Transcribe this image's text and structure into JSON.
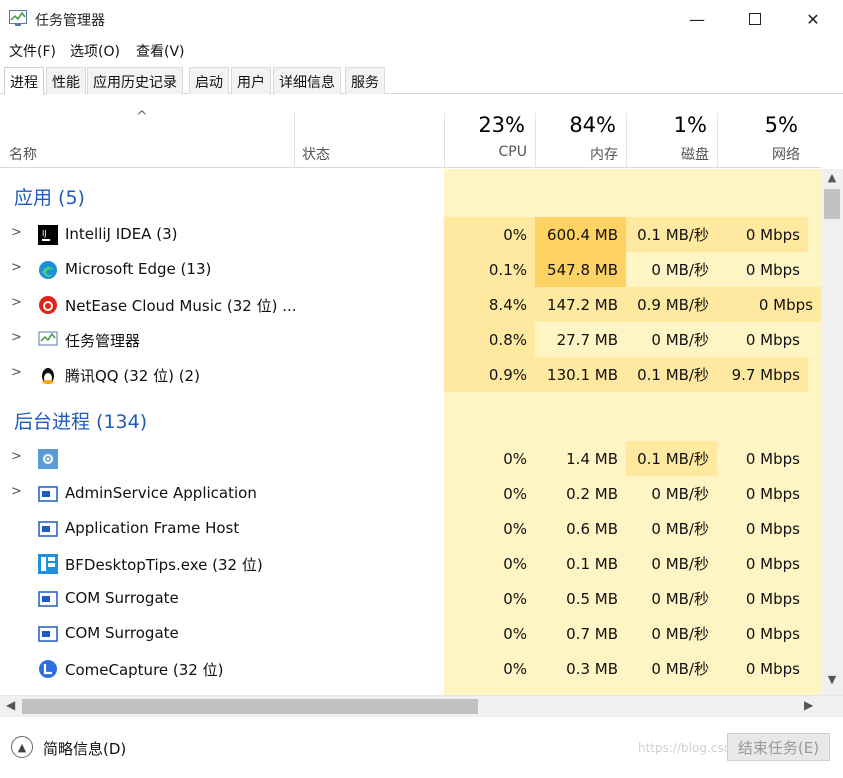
{
  "window": {
    "title": "任务管理器"
  },
  "menu": [
    "文件(F)",
    "选项(O)",
    "查看(V)"
  ],
  "tabs": [
    "进程",
    "性能",
    "应用历史记录",
    "启动",
    "用户",
    "详细信息",
    "服务"
  ],
  "header": {
    "name": "名称",
    "status": "状态",
    "cpu": {
      "pct": "23%",
      "label": "CPU"
    },
    "mem": {
      "pct": "84%",
      "label": "内存"
    },
    "disk": {
      "pct": "1%",
      "label": "磁盘"
    },
    "net": {
      "pct": "5%",
      "label": "网络"
    }
  },
  "groups": {
    "apps": "应用 (5)",
    "background": "后台进程 (134)"
  },
  "apps": [
    {
      "name": "IntelliJ IDEA (3)",
      "cpu": "0%",
      "mem": "600.4 MB",
      "disk": "0.1 MB/秒",
      "net": "0 Mbps"
    },
    {
      "name": "Microsoft Edge (13)",
      "cpu": "0.1%",
      "mem": "547.8 MB",
      "disk": "0 MB/秒",
      "net": "0 Mbps"
    },
    {
      "name": "NetEase Cloud Music (32 位) ...",
      "cpu": "8.4%",
      "mem": "147.2 MB",
      "disk": "0.9 MB/秒",
      "net": "0 Mbps"
    },
    {
      "name": "任务管理器",
      "cpu": "0.8%",
      "mem": "27.7 MB",
      "disk": "0 MB/秒",
      "net": "0 Mbps"
    },
    {
      "name": "腾讯QQ (32 位) (2)",
      "cpu": "0.9%",
      "mem": "130.1 MB",
      "disk": "0.1 MB/秒",
      "net": "9.7 Mbps"
    }
  ],
  "background": [
    {
      "name": "",
      "cpu": "0%",
      "mem": "1.4 MB",
      "disk": "0.1 MB/秒",
      "net": "0 Mbps"
    },
    {
      "name": "AdminService Application",
      "cpu": "0%",
      "mem": "0.2 MB",
      "disk": "0 MB/秒",
      "net": "0 Mbps"
    },
    {
      "name": "Application Frame Host",
      "cpu": "0%",
      "mem": "0.6 MB",
      "disk": "0 MB/秒",
      "net": "0 Mbps"
    },
    {
      "name": "BFDesktopTips.exe (32 位)",
      "cpu": "0%",
      "mem": "0.1 MB",
      "disk": "0 MB/秒",
      "net": "0 Mbps"
    },
    {
      "name": "COM Surrogate",
      "cpu": "0%",
      "mem": "0.5 MB",
      "disk": "0 MB/秒",
      "net": "0 Mbps"
    },
    {
      "name": "COM Surrogate",
      "cpu": "0%",
      "mem": "0.7 MB",
      "disk": "0 MB/秒",
      "net": "0 Mbps"
    },
    {
      "name": "ComeCapture (32 位)",
      "cpu": "0%",
      "mem": "0.3 MB",
      "disk": "0 MB/秒",
      "net": "0 Mbps"
    }
  ],
  "footer": {
    "fewer_details": "简略信息(D)",
    "end_task": "结束任务(E)",
    "watermark": "https://blog.csdn.net/a_lulu"
  },
  "colors": {
    "accent": "#1f5bbf",
    "heat_low": "#fff4c4",
    "heat_mid": "#ffe9a0",
    "heat_high": "#ffd264"
  }
}
